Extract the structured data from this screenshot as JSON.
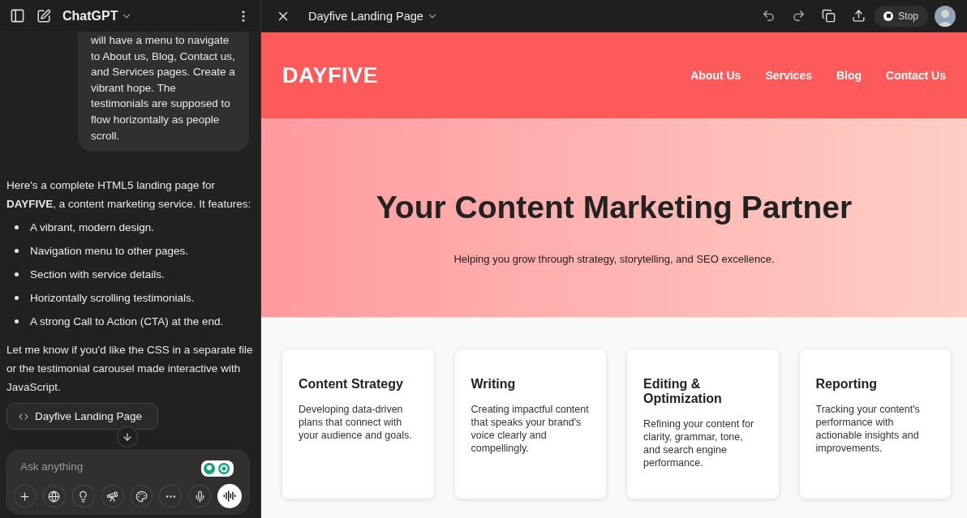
{
  "sidebar": {
    "title": "ChatGPT"
  },
  "chat": {
    "user_message_lines": [
      "will have a menu to navigate",
      "to About us, Blog, Contact us,",
      "and Services pages. Create a",
      "vibrant hope. The",
      "testimonials are supposed to",
      "flow horizontally as people",
      "scroll."
    ],
    "reply_intro": "Here's a complete HTML5 landing page for **DAYFIVE**, a content marketing service. It features:",
    "features": [
      "A vibrant, modern design.",
      "Navigation menu to other pages.",
      "Section with service details.",
      "Horizontally scrolling testimonials.",
      "A strong Call to Action (CTA) at the end."
    ],
    "reply_outro": "Let me know if you'd like the CSS in a separate file or the testimonial carousel made interactive with JavaScript.",
    "canvas_chip": "Dayfive Landing Page"
  },
  "composer": {
    "placeholder": "Ask anything"
  },
  "canvas": {
    "title": "Dayfive Landing Page",
    "stop_label": "Stop"
  },
  "site": {
    "logo": "DAYFIVE",
    "nav": [
      "About Us",
      "Services",
      "Blog",
      "Contact Us"
    ],
    "hero_title": "Your Content Marketing Partner",
    "hero_subtitle": "Helping you grow through strategy, storytelling, and SEO excellence.",
    "services": [
      {
        "title": "Content Strategy",
        "text": "Developing data-driven plans that connect with your audience and goals."
      },
      {
        "title": "Writing",
        "text": "Creating impactful content that speaks your brand's voice clearly and compellingly."
      },
      {
        "title": "Editing & Optimization",
        "text": "Refining your content for clarity, grammar, tone, and search engine performance."
      },
      {
        "title": "Reporting",
        "text": "Tracking your content's performance with actionable insights and improvements."
      }
    ]
  }
}
